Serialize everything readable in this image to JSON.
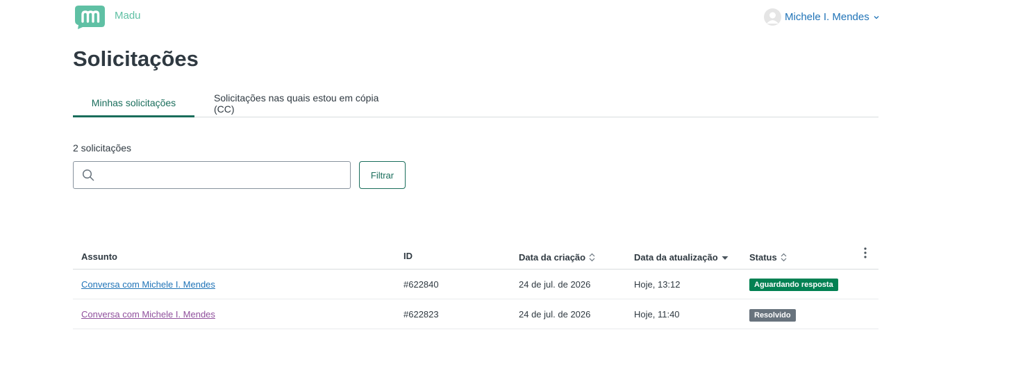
{
  "header": {
    "brand": "Madu",
    "user_name": "Michele I. Mendes"
  },
  "page": {
    "title": "Solicitações"
  },
  "tabs": [
    {
      "label": "Minhas solicitações",
      "active": true
    },
    {
      "label": "Solicitações nas quais estou em cópia (CC)",
      "active": false
    }
  ],
  "list": {
    "count_text": "2 solicitações",
    "search_value": "",
    "filter_label": "Filtrar"
  },
  "table": {
    "columns": [
      "Assunto",
      "ID",
      "Data da criação",
      "Data da atualização",
      "Status"
    ],
    "rows": [
      {
        "subject": "Conversa com Michele I. Mendes",
        "id": "#622840",
        "created": "24 de jul. de 2026",
        "updated": "Hoje, 13:12",
        "status": "Aguardando resposta"
      },
      {
        "subject": "Conversa com Michele I. Mendes",
        "id": "#622823",
        "created": "24 de jul. de 2026",
        "updated": "Hoje, 11:40",
        "status": "Resolvido"
      }
    ]
  },
  "colors": {
    "accent": "#196d5b",
    "logo": "#5fc0a4",
    "link": "#1f73b7",
    "visited_link": "#8f4f9c",
    "status_awaiting": "#038153",
    "status_solved": "#68737d"
  },
  "icons": [
    "logo-icon",
    "avatar-icon",
    "chevron-down-icon",
    "search-icon",
    "sort-icon",
    "sort-down-icon",
    "more-vertical-icon"
  ]
}
